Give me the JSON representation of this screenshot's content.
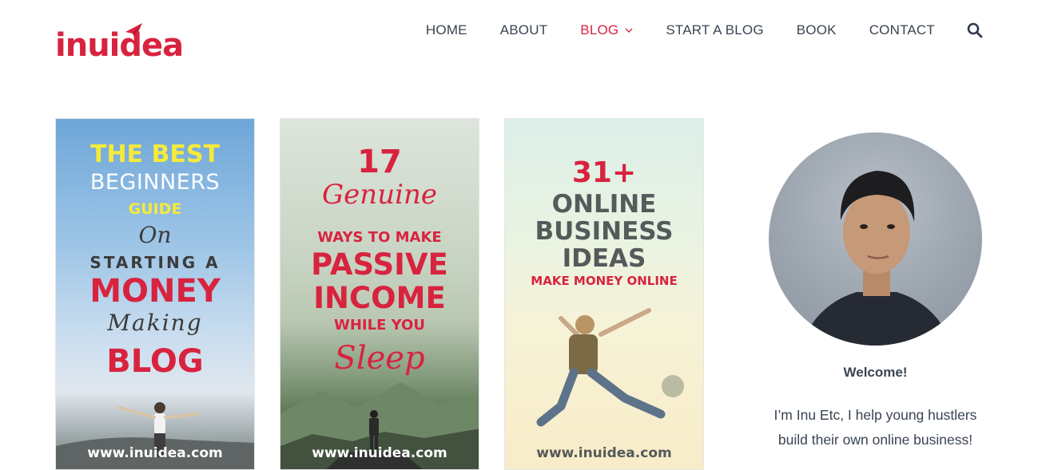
{
  "logo": {
    "text": "inuidea",
    "brand_color": "#d8233f"
  },
  "nav": {
    "items": [
      {
        "label": "HOME",
        "active": false
      },
      {
        "label": "ABOUT",
        "active": false
      },
      {
        "label": "BLOG",
        "active": true,
        "has_dropdown": true
      },
      {
        "label": "START A BLOG",
        "active": false
      },
      {
        "label": "BOOK",
        "active": false
      },
      {
        "label": "CONTACT",
        "active": false
      }
    ],
    "search_icon": "search-icon"
  },
  "cards": [
    {
      "lines": [
        "THE BEST",
        "BEGINNERS",
        "GUIDE",
        "On",
        "STARTING A",
        "MONEY",
        "Making",
        "BLOG"
      ],
      "url": "www.inuidea.com"
    },
    {
      "lines": [
        "17",
        "Genuine",
        "WAYS TO MAKE",
        "PASSIVE",
        "INCOME",
        "WHILE YOU",
        "Sleep"
      ],
      "url": "www.inuidea.com"
    },
    {
      "lines": [
        "31+",
        "ONLINE",
        "BUSINESS",
        "IDEAS",
        "MAKE MONEY ONLINE"
      ],
      "url": "www.inuidea.com"
    }
  ],
  "sidebar": {
    "welcome": "Welcome!",
    "bio": "I’m Inu Etc, I help young hustlers build their own online business!"
  },
  "colors": {
    "accent": "#d8233f",
    "text": "#3a4451",
    "highlight_yellow": "#f5ea3b"
  }
}
